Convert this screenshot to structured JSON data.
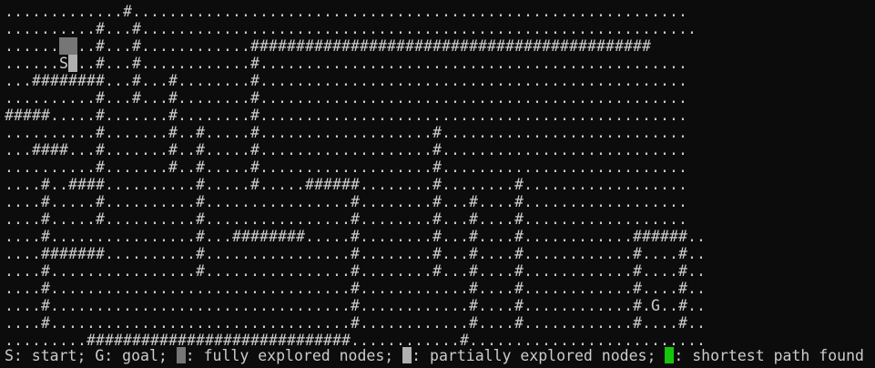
{
  "grid": {
    "rows": [
      ".............#.............................................................",
      "..........#...#.............................................................",
      "......  ..#...#............############################################",
      "......S ..#...#............#...............................................",
      "...########...#...#........#...............................................",
      "..........#...#...#........#...............................................",
      "#####.....#.......#........#...............................................",
      "..........#.......#..#.....#...................#...........................",
      "...####...#.......#..#.....#...................#...........................",
      "..........#.......#..#.....#...................#...........................",
      "....#..####..........#.....#.....######........#........#..................",
      "....#.....#..........#................#........#...#....#..................",
      "....#.....#..........#................#........#...#....#..................",
      "....#................#...########.....#........#...#....#............######..",
      "....#######..........#................#........#...#....#............#....#..",
      "....#................#................#........#...#....#............#....#..",
      "....#.................................#............#....#............#....#..",
      "....#.................................#............#....#............#.G..#..",
      "....#.................................#............#....#............#....#..",
      ".........#############################............#.........................."
    ],
    "explored_cells": [
      [
        2,
        6
      ],
      [
        2,
        7
      ]
    ],
    "partial_cells": [
      [
        3,
        7
      ]
    ]
  },
  "legend": {
    "start": "S: start; ",
    "goal": "G: goal; ",
    "full": ": fully explored nodes; ",
    "partial": ": partially explored nodes; ",
    "path": ": shortest path found"
  },
  "colors": {
    "background": "#0c0c0c",
    "text": "#cccccc",
    "fully_explored": "#767676",
    "partially_explored": "#b0b0b0",
    "shortest_path": "#16c60c"
  }
}
